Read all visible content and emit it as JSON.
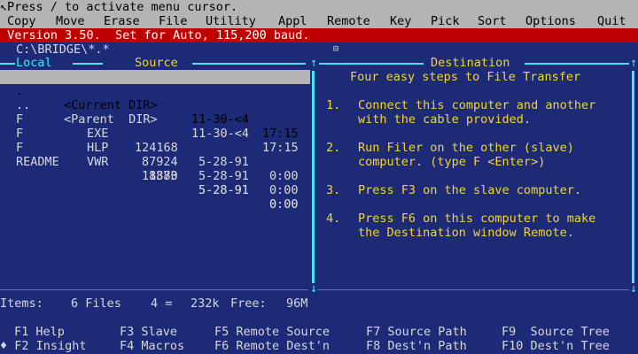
{
  "hint": "Press / to activate menu cursor.",
  "menu": [
    "Copy",
    "Move",
    "Erase",
    "File",
    "Utility",
    "Appl",
    "Remote",
    "Key",
    "Pick",
    "Sort",
    "Options",
    "Quit"
  ],
  "status": " Version 3.50.  Set for Auto, 115,200 baud.",
  "path": "C:\\BRIDGE\\*.*",
  "left_panel": {
    "header_local": "Local",
    "header_source": "Source",
    "files": [
      {
        "name": ".",
        "ext": "",
        "size": "<Current DIR>",
        "date": "11-30-<4",
        "time": "17:15",
        "selected": true
      },
      {
        "name": "..",
        "ext": "",
        "size": "<Parent  DIR>",
        "date": "11-30-<4",
        "time": "17:15",
        "selected": false
      },
      {
        "name": "F",
        "ext": "EXE",
        "size": "124168",
        "date": "5-28-91",
        "time": "0:00",
        "selected": false
      },
      {
        "name": "F",
        "ext": "HLP",
        "size": "87924",
        "date": "5-28-91",
        "time": "0:00",
        "selected": false
      },
      {
        "name": "F",
        "ext": "VWR",
        "size": "18880",
        "date": "5-28-91",
        "time": "0:00",
        "selected": false
      },
      {
        "name": "README",
        "ext": "",
        "size": "1373",
        "date": "5-28-91",
        "time": "0:00",
        "selected": false
      }
    ],
    "items_label": "Items:",
    "items_count": "6 Files",
    "items_blocks": "4 =",
    "items_size": "232k",
    "free_label": "Free:",
    "free_value": "96M"
  },
  "right_panel": {
    "header": "Destination",
    "title": "Four easy steps to File Transfer",
    "steps": [
      {
        "num": "1.",
        "line1": "Connect this computer and another",
        "line2": "with the cable provided."
      },
      {
        "num": "2.",
        "line1": "Run Filer on the other (slave)",
        "line2": "computer. (type F <Enter>)"
      },
      {
        "num": "3.",
        "line1": "Press F3 on the slave computer.",
        "line2": ""
      },
      {
        "num": "4.",
        "line1": "Press F6 on this computer to make",
        "line2": "the Destination window Remote."
      }
    ]
  },
  "fkeys": [
    {
      "row1": "F1 Help",
      "row2": "♦ F2 Insight"
    },
    {
      "row1": "F3 Slave",
      "row2": "F4 Macros"
    },
    {
      "row1": "F5 Remote Source",
      "row2": "F6 Remote Dest'n"
    },
    {
      "row1": "F7 Source Path",
      "row2": "F8 Dest'n Path"
    },
    {
      "row1": "F9  Source Tree",
      "row2": "F10 Dest'n Tree"
    }
  ],
  "colors": {
    "background": "#1c2a78",
    "menu": "#b4b4b4",
    "status": "#c00000",
    "accent": "#48e4f4",
    "text": "#d8d8d8",
    "highlight": "#f4d23c"
  }
}
